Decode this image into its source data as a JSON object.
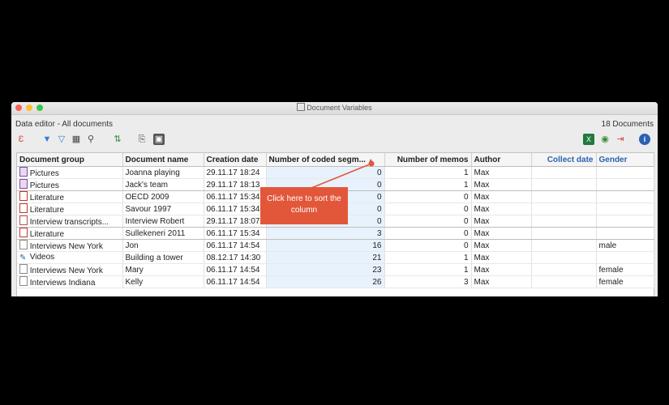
{
  "window": {
    "title": "Document Variables"
  },
  "header": {
    "subtitle": "Data editor - All documents",
    "count": "18 Documents"
  },
  "toolbar": {
    "left_icons": [
      "variable-list-icon",
      "filter-icon",
      "filter-clear-icon",
      "table-icon",
      "search-icon",
      "sort-icon",
      "copy-icon",
      "layout-icon"
    ],
    "right_icons": [
      "excel-export-icon",
      "web-export-icon",
      "export-icon",
      "info-icon"
    ]
  },
  "table": {
    "columns": [
      "Document group",
      "Document name",
      "Creation date",
      "Number of coded segm...",
      "Number of memos",
      "Author",
      "Collect date",
      "Gender"
    ],
    "rows": [
      {
        "icon": "picture-document-icon",
        "group": "Pictures",
        "name": "Joanna playing",
        "date": "29.11.17 18:24",
        "coded": "0",
        "memos": "1",
        "author": "Max",
        "collect": "",
        "gender": ""
      },
      {
        "icon": "picture-document-icon",
        "group": "Pictures",
        "name": "Jack's team",
        "date": "29.11.17 18:13",
        "coded": "0",
        "memos": "1",
        "author": "Max",
        "collect": "",
        "gender": ""
      },
      {
        "icon": "pdf-document-icon",
        "group": "Literature",
        "name": "OECD 2009",
        "date": "06.11.17 15:34",
        "coded": "0",
        "memos": "0",
        "author": "Max",
        "collect": "",
        "gender": ""
      },
      {
        "icon": "pdf-document-icon",
        "group": "Literature",
        "name": "Savour 1997",
        "date": "06.11.17 15:34",
        "coded": "0",
        "memos": "0",
        "author": "Max",
        "collect": "",
        "gender": ""
      },
      {
        "icon": "transcript-document-icon",
        "group": "Interview transcripts...",
        "name": "Interview Robert",
        "date": "29.11.17 18:07",
        "coded": "0",
        "memos": "0",
        "author": "Max",
        "collect": "",
        "gender": ""
      },
      {
        "icon": "pdf-document-icon",
        "group": "Literature",
        "name": "Sullekeneri 2011",
        "date": "06.11.17 15:34",
        "coded": "3",
        "memos": "0",
        "author": "Max",
        "collect": "",
        "gender": ""
      },
      {
        "icon": "text-document-icon",
        "group": "Interviews New York",
        "name": "Jon",
        "date": "06.11.17 14:54",
        "coded": "16",
        "memos": "0",
        "author": "Max",
        "collect": "",
        "gender": "male"
      },
      {
        "icon": "video-document-icon",
        "group": "Videos",
        "name": "Building a tower",
        "date": "08.12.17 14:30",
        "coded": "21",
        "memos": "1",
        "author": "Max",
        "collect": "",
        "gender": ""
      },
      {
        "icon": "text-document-icon",
        "group": "Interviews New York",
        "name": "Mary",
        "date": "06.11.17 14:54",
        "coded": "23",
        "memos": "1",
        "author": "Max",
        "collect": "",
        "gender": "female"
      },
      {
        "icon": "text-document-icon",
        "group": "Interviews Indiana",
        "name": "Kelly",
        "date": "06.11.17 14:54",
        "coded": "26",
        "memos": "3",
        "author": "Max",
        "collect": "",
        "gender": "female"
      }
    ]
  },
  "callout": {
    "text": "Click here to sort the column"
  },
  "colors": {
    "callout": "#e2573a",
    "selected_column": "#e8f2fc",
    "accent": "#2b62b0"
  }
}
